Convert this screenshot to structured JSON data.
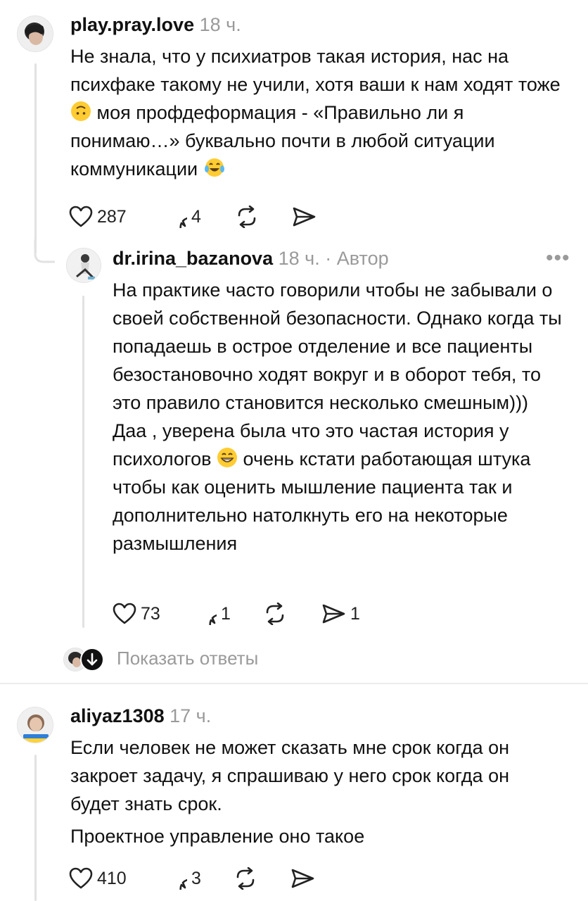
{
  "comments": [
    {
      "username": "play.pray.love",
      "time": "18 ч.",
      "text_parts": [
        "Не знала, что у психиатров такая история, нас на психфаке такому не учили, хотя ваши к нам ходят тоже ",
        " моя профдеформация - «Правильно ли я понимаю…» буквально почти в любой ситуации коммуникации "
      ],
      "emojis": [
        "upside-down-face-emoji",
        "tears-of-joy-emoji"
      ],
      "likes": "287",
      "replies": "4"
    },
    {
      "username": "dr.irina_bazanova",
      "time": "18 ч.",
      "separator": "·",
      "author_badge": "Автор",
      "more": "•••",
      "text_parts": [
        "На практике часто говорили чтобы не забывали о своей собственной безопасности. Однако когда ты попадаешь в острое отделение и все пациенты безостановочно ходят вокруг и в оборот тебя, то это правило становится несколько смешным))) Даа , уверена была что это частая история у психологов ",
        " очень кстати работающая штука чтобы как оценить мышление пациента так и дополнительно натолкнуть его на некоторые размышления"
      ],
      "emojis": [
        "grinning-face-emoji"
      ],
      "likes": "73",
      "replies": "1",
      "shares": "1"
    },
    {
      "username": "aliyaz1308",
      "time": "17 ч.",
      "paragraphs": [
        "Если человек не может сказать мне срок когда он закроет задачу, я спрашиваю у него срок когда он будет знать срок.",
        "Проектное управление оно такое"
      ],
      "likes": "410",
      "replies": "3"
    }
  ],
  "show_replies_label": "Показать ответы",
  "icons": {
    "like": "heart-icon",
    "reply": "speech-bubble-icon",
    "repost": "repost-icon",
    "share": "send-icon",
    "expand": "arrow-down-icon"
  },
  "colors": {
    "text": "#111111",
    "muted": "#9a9a9a",
    "thread_line": "#e2e2e2",
    "emoji_yellow": "#ffcc33"
  }
}
